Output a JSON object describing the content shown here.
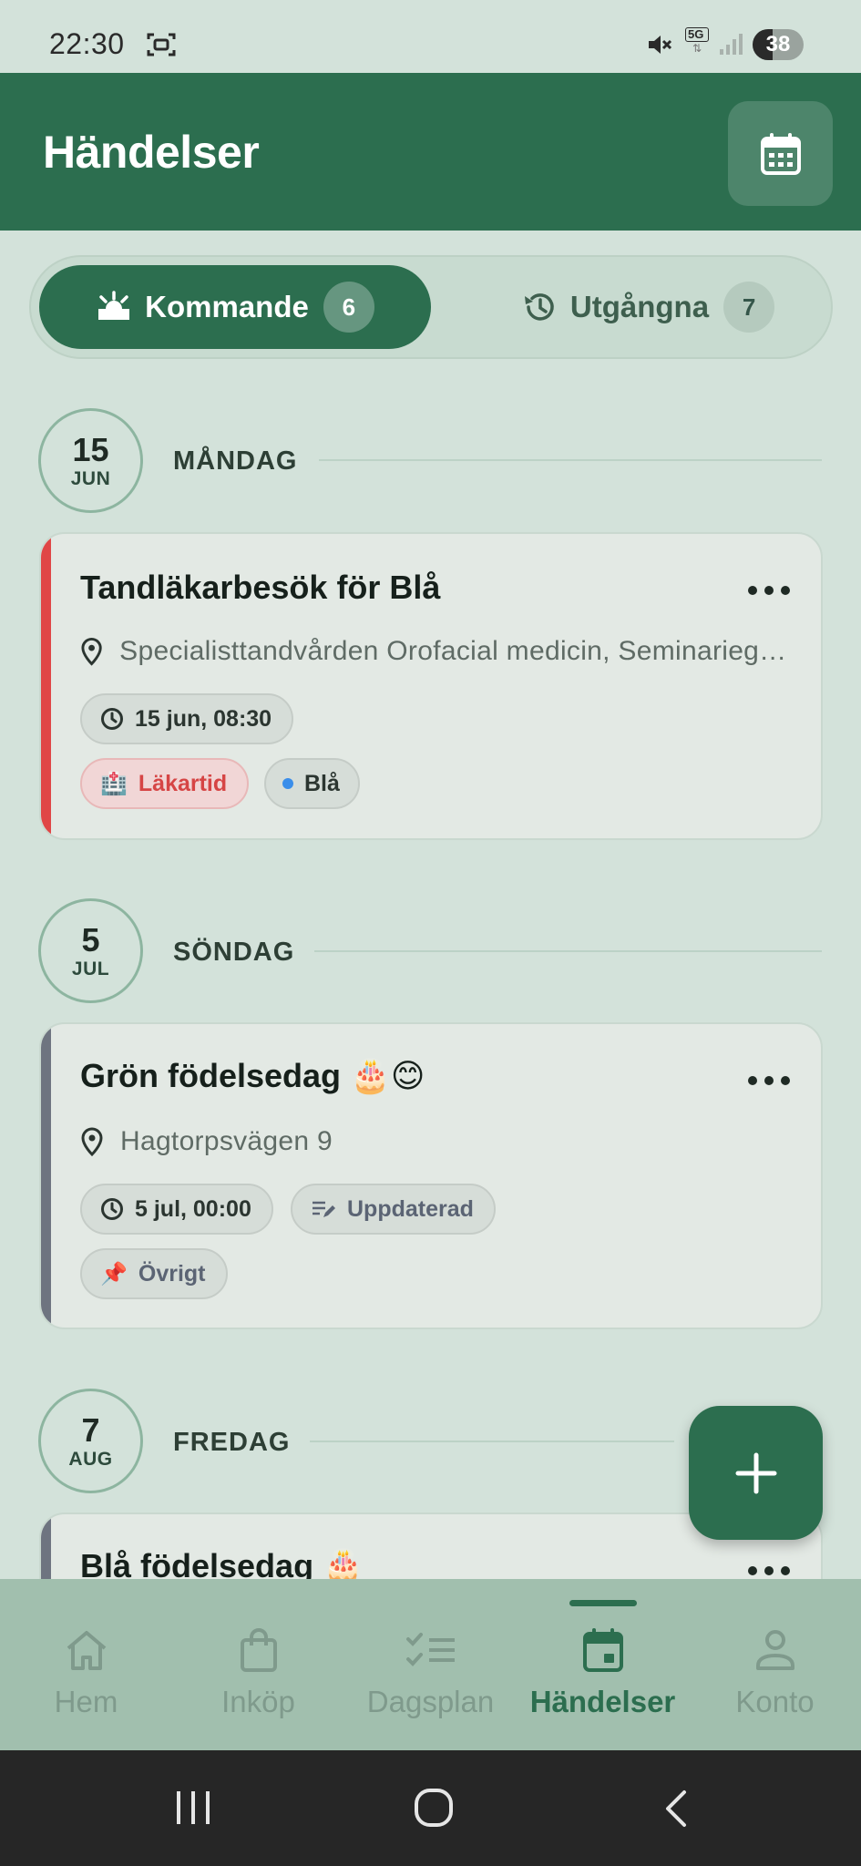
{
  "status_bar": {
    "time": "22:30",
    "network": "5G",
    "battery": "38"
  },
  "header": {
    "title": "Händelser",
    "calendar_icon": "calendar-icon"
  },
  "tabs": [
    {
      "label": "Kommande",
      "count": "6",
      "icon": "sunrise-icon",
      "active": true
    },
    {
      "label": "Utgångna",
      "count": "7",
      "icon": "history-icon",
      "active": false
    }
  ],
  "groups": [
    {
      "day": "15",
      "month": "JUN",
      "weekday": "MÅNDAG",
      "event": {
        "title": "Tandläkarbesök för Blå",
        "location": "Specialisttandvården Orofacial medicin, Seminariegatan",
        "time": "15 jun, 08:30",
        "category": "Läkartid",
        "category_icon": "🏥",
        "member": "Blå",
        "stripe_color": "#e04646"
      }
    },
    {
      "day": "5",
      "month": "JUL",
      "weekday": "SÖNDAG",
      "event": {
        "title": "Grön födelsedag 🎂😊",
        "location": "Hagtorpsvägen 9",
        "time": "5 jul, 00:00",
        "status": "Uppdaterad",
        "category": "Övrigt",
        "category_icon": "📌",
        "stripe_color": "#6e7480"
      }
    },
    {
      "day": "7",
      "month": "AUG",
      "weekday": "FREDAG",
      "event": {
        "title": "Blå födelsedag 🎂",
        "stripe_color": "#6e7480"
      }
    }
  ],
  "fab": {
    "icon": "plus-icon"
  },
  "bottom_nav": [
    {
      "label": "Hem",
      "icon": "home-icon"
    },
    {
      "label": "Inköp",
      "icon": "shopping-bag-icon"
    },
    {
      "label": "Dagsplan",
      "icon": "checklist-icon"
    },
    {
      "label": "Händelser",
      "icon": "calendar-event-icon",
      "active": true
    },
    {
      "label": "Konto",
      "icon": "person-icon"
    }
  ],
  "colors": {
    "primary": "#2c6e4f",
    "background": "#d3e2da",
    "medical": "#e04646",
    "member_blue": "#3a8eea"
  }
}
